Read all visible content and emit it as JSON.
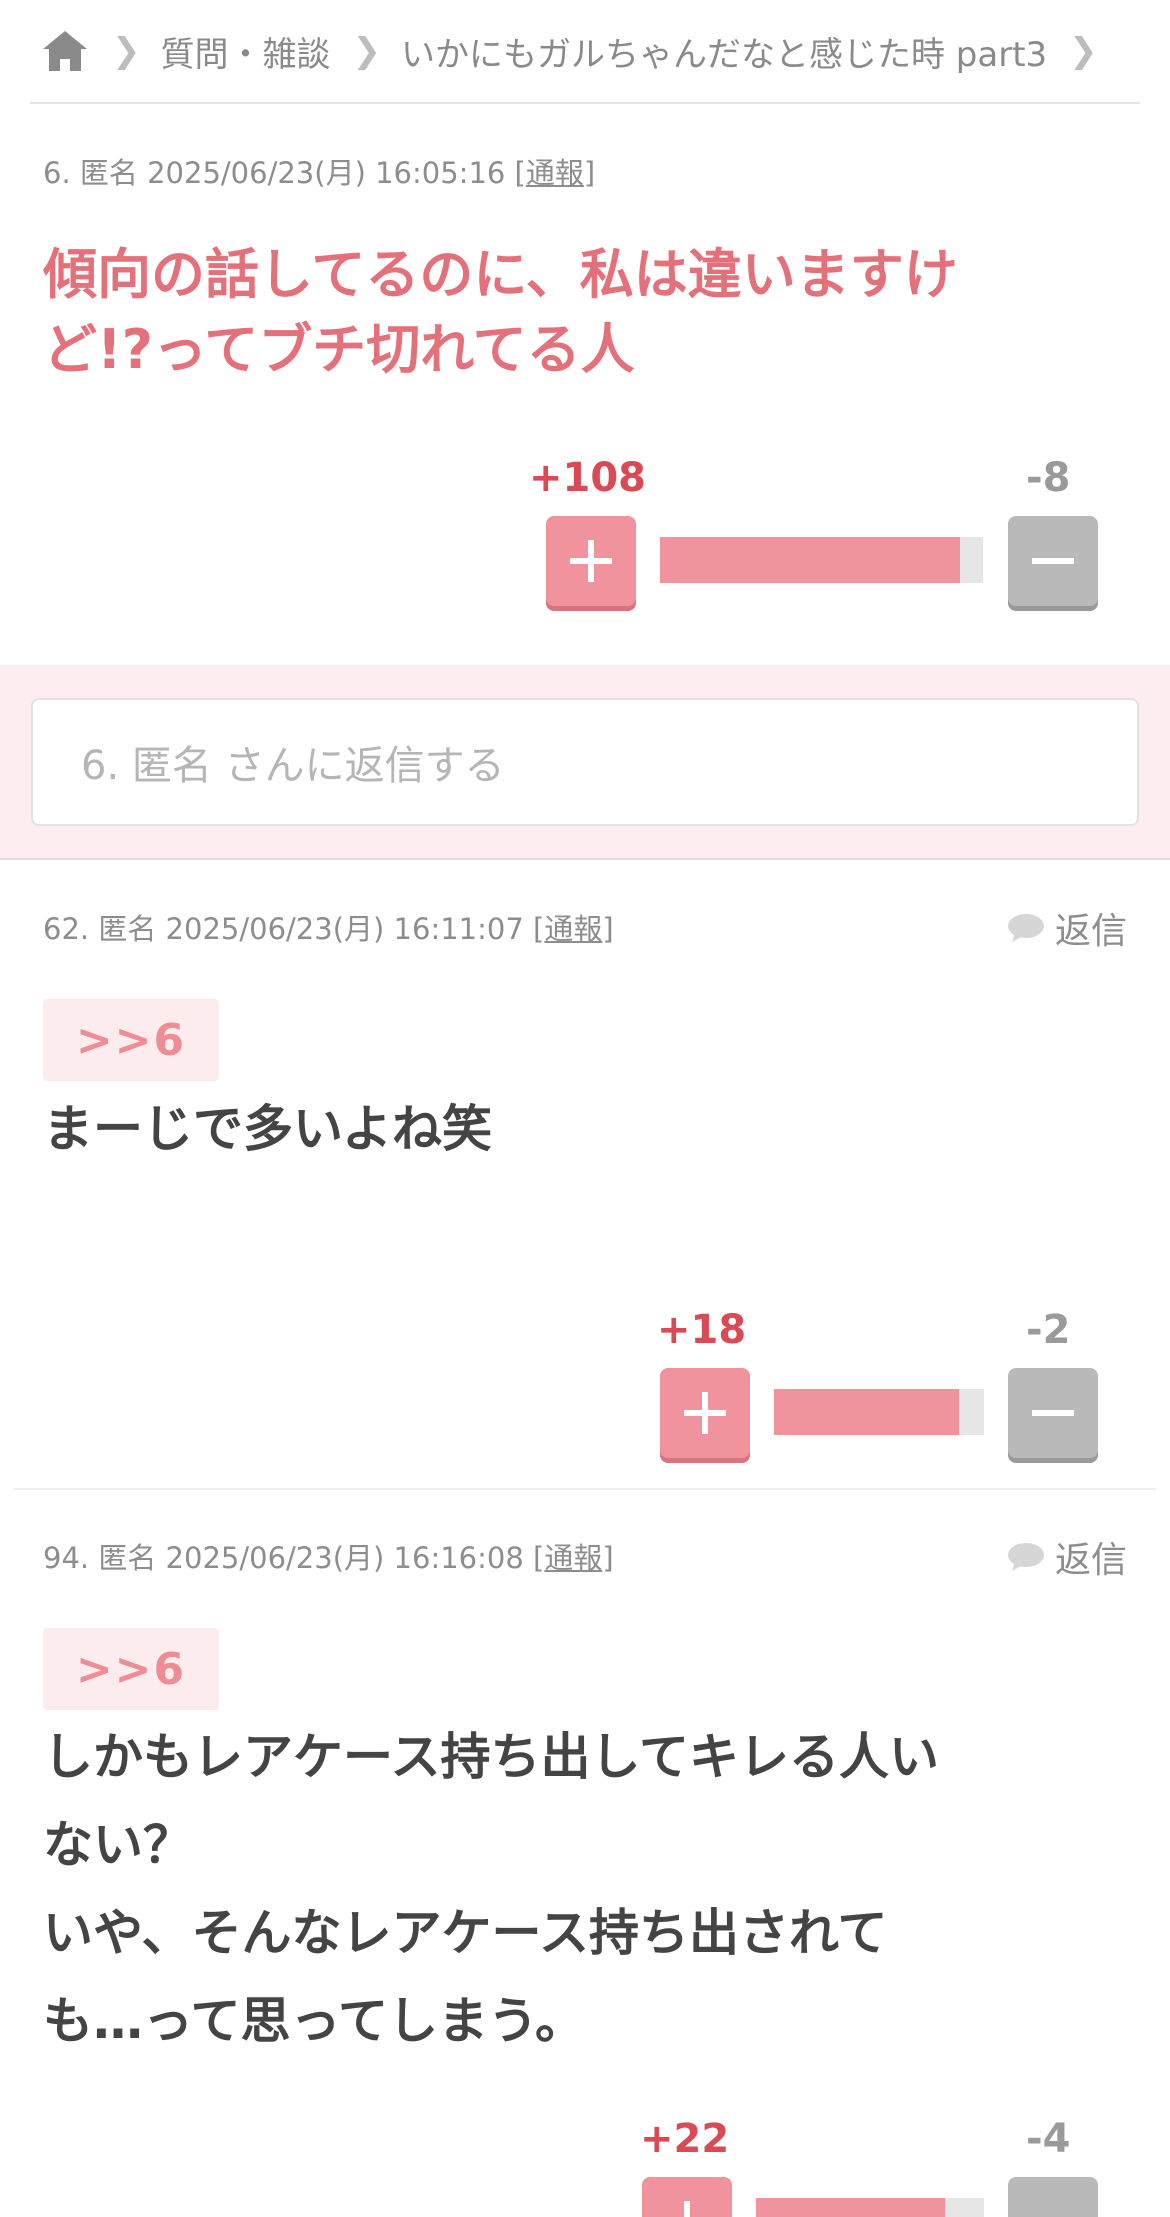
{
  "breadcrumb": {
    "items": [
      "質問・雑談",
      "いかにもガルちゃんだなと感じた時 part3"
    ]
  },
  "comments": [
    {
      "meta_prefix": "6. 匿名 2025/06/23(月) 16:05:16 [",
      "report": "通報",
      "meta_suffix": "]",
      "lines": [
        "傾向の話してるのに、私は違いますけ",
        "ど!?ってブチ切れてる人"
      ],
      "plus": "+108",
      "minus": "-8",
      "plus_ratio": 0.93
    },
    {
      "meta_prefix": "62. 匿名 2025/06/23(月) 16:11:07 [",
      "report": "通報",
      "meta_suffix": "]",
      "reply_label": "返信",
      "anchor": ">>6",
      "lines": [
        "まーじで多いよね笑"
      ],
      "plus": "+18",
      "minus": "-2",
      "plus_ratio": 0.88
    },
    {
      "meta_prefix": "94. 匿名 2025/06/23(月) 16:16:08 [",
      "report": "通報",
      "meta_suffix": "]",
      "reply_label": "返信",
      "anchor": ">>6",
      "lines": [
        "しかもレアケース持ち出してキレる人い",
        "ない？",
        "いや、そんなレアケース持ち出されて",
        "も…って思ってしまう。"
      ],
      "plus": "+22",
      "minus": "-4",
      "plus_ratio": 0.83
    }
  ],
  "reply_box": {
    "placeholder": "6. 匿名 さんに返信する"
  },
  "colors": {
    "accent": "#e4707a",
    "plus_button": "#f0939c",
    "plus_count": "#d94a55",
    "minus_button": "#b9b9b9",
    "reply_bg": "#fdedf0"
  }
}
